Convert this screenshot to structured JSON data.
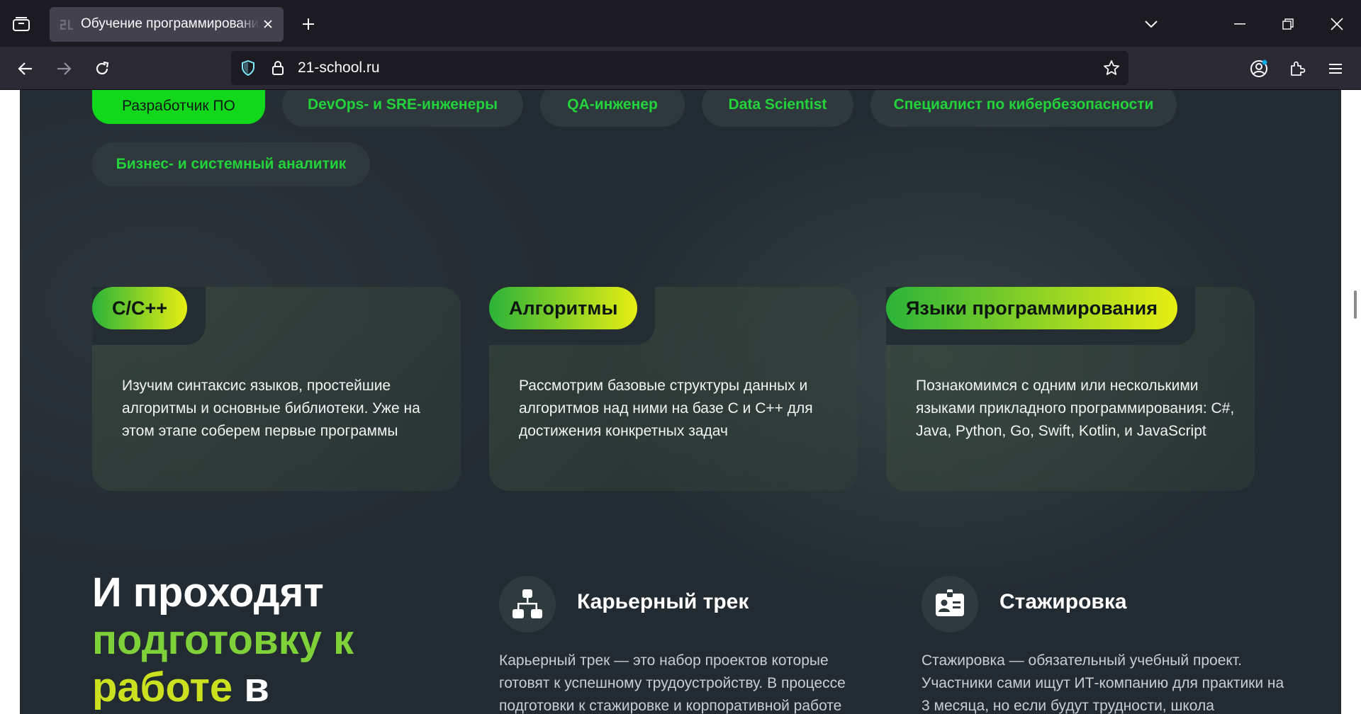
{
  "browser": {
    "tab_title": "Обучение программированию",
    "url": "21-school.ru",
    "colors": {
      "chrome_bg": "#1c1b22",
      "toolbar_bg": "#2b2a33",
      "tab_active": "#42414d"
    }
  },
  "site": {
    "profession_tabs": [
      {
        "label": "Разработчик ПО",
        "active": true
      },
      {
        "label": "DevOps- и SRE-инженеры",
        "active": false
      },
      {
        "label": "QA-инженер",
        "active": false
      },
      {
        "label": "Data Scientist",
        "active": false
      },
      {
        "label": "Специалист по кибербезопасности",
        "active": false
      },
      {
        "label": "Бизнес- и системный аналитик",
        "active": false
      }
    ],
    "cards": [
      {
        "tag": "C/C++",
        "text": "Изучим синтаксис языков, простейшие алгоритмы и основные библиотеки. Уже на этом этапе соберем первые программы"
      },
      {
        "tag": "Алгоритмы",
        "text": "Рассмотрим базовые структуры данных и алгоритмов над ними на базе С и C++ для достижения конкретных задач"
      },
      {
        "tag": "Языки программирования",
        "text": "Познакомимся с одним или несколькими языками прикладного программирования: C#, Java, Python, Go, Swift, Kotlin, и JavaScript"
      }
    ],
    "heading": {
      "part1": "И проходят",
      "part2": "подготовку к",
      "part3": "работе",
      "part4": "в"
    },
    "features": [
      {
        "title": "Карьерный трек",
        "icon": "sitemap-icon",
        "text": "Карьерный трек — это набор проектов которые готовят к успешному трудоустройству. В процессе подготовки к стажировке и корпоративной работе"
      },
      {
        "title": "Стажировка",
        "icon": "id-badge-icon",
        "text": "Стажировка — обязательный учебный проект. Участники сами ищут ИТ-компанию для практики на 3 месяца, но если будут трудности, школа"
      }
    ],
    "colors": {
      "accent_green": "#12d81c",
      "tab_text_green": "#22d33b",
      "bg": "#222b31"
    }
  }
}
